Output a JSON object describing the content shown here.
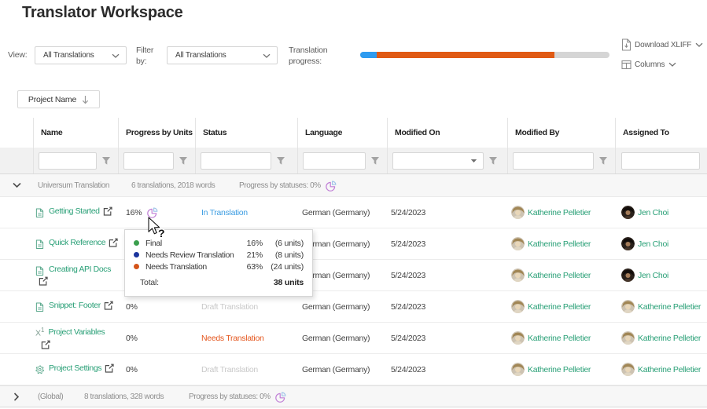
{
  "page": {
    "title": "Translator Workspace"
  },
  "toolbar": {
    "view_label": "View:",
    "view_value": "All Translations",
    "filter_label_line1": "Filter",
    "filter_label_line2": "by:",
    "filter_value": "All Translations",
    "progress_label_line1": "Translation",
    "progress_label_line2": "progress:",
    "download_label": "Download XLIFF",
    "columns_label": "Columns"
  },
  "sort": {
    "label": "Project Name"
  },
  "progress_bar": {
    "segments": [
      {
        "name": "final",
        "color": "#2e9bf0",
        "fraction": 0.066
      },
      {
        "name": "needs-translation",
        "color": "#e05a14",
        "fraction": 0.713
      },
      {
        "name": "remaining",
        "color": "#d5d5d5",
        "fraction": 0.221
      }
    ]
  },
  "table": {
    "columns": [
      "Name",
      "Progress by Units",
      "Status",
      "Language",
      "Modified On",
      "Modified By",
      "Assigned To"
    ],
    "group": {
      "name": "Universum Translation",
      "summary": "6 translations, 2018 words",
      "progress": "Progress by statuses: 0%"
    },
    "rows": [
      {
        "name": "Getting Started",
        "icon": "document",
        "progress": "16%",
        "status": "In Translation",
        "language": "German (Germany)",
        "modified_on": "5/24/2023",
        "modified_by": "Katherine Pelletier",
        "assigned_to": "Jen Choi"
      },
      {
        "name": "Quick Reference",
        "icon": "document",
        "progress": "",
        "status": "",
        "language": "German (Germany)",
        "modified_on": "5/24/2023",
        "modified_by": "Katherine Pelletier",
        "assigned_to": "Jen Choi"
      },
      {
        "name": "Creating API Docs",
        "icon": "document",
        "progress": "",
        "status": "",
        "language": "German (Germany)",
        "modified_on": "5/24/2023",
        "modified_by": "Katherine Pelletier",
        "assigned_to": "Jen Choi"
      },
      {
        "name": "Snippet: Footer",
        "icon": "document",
        "progress": "0%",
        "status": "Draft Translation",
        "language": "German (Germany)",
        "modified_on": "5/24/2023",
        "modified_by": "Katherine Pelletier",
        "assigned_to": "Katherine Pelletier"
      },
      {
        "name": "Project Variables",
        "icon": "variable",
        "progress": "0%",
        "status": "Needs Translation",
        "language": "German (Germany)",
        "modified_on": "5/24/2023",
        "modified_by": "Katherine Pelletier",
        "assigned_to": "Katherine Pelletier"
      },
      {
        "name": "Project Settings",
        "icon": "gear",
        "progress": "0%",
        "status": "Draft Translation",
        "language": "German (Germany)",
        "modified_on": "5/24/2023",
        "modified_by": "Katherine Pelletier",
        "assigned_to": "Katherine Pelletier"
      }
    ],
    "footer": {
      "name": "(Global)",
      "summary": "8 translations, 328 words",
      "progress": "Progress by statuses: 0%"
    }
  },
  "tooltip": {
    "items": [
      {
        "label": "Final",
        "pct": "16%",
        "units": "(6 units)",
        "color": "#3a9e4d"
      },
      {
        "label": "Needs Review Translation",
        "pct": "21%",
        "units": "(8 units)",
        "color": "#1b349d"
      },
      {
        "label": "Needs Translation",
        "pct": "63%",
        "units": "(24 units)",
        "color": "#d4541a"
      }
    ],
    "total_label": "Total:",
    "total_value": "38 units"
  },
  "colors": {
    "link_green": "#2aa077",
    "status_in_translation": "#3d9de2",
    "status_draft": "#c9c9c9",
    "status_needs_translation": "#e4571f",
    "progress_blue": "#2e9bf0",
    "progress_orange": "#e05a14",
    "pie_icon_purple": "#c07fd6",
    "pie_icon_blue": "#9fc3e8"
  },
  "icons": {
    "download": "document-arrow-down",
    "columns": "table-columns",
    "chevron": "chevron-down",
    "filter": "funnel",
    "pie": "pie-chart",
    "external": "external-link",
    "cursor": "help-pointer"
  }
}
